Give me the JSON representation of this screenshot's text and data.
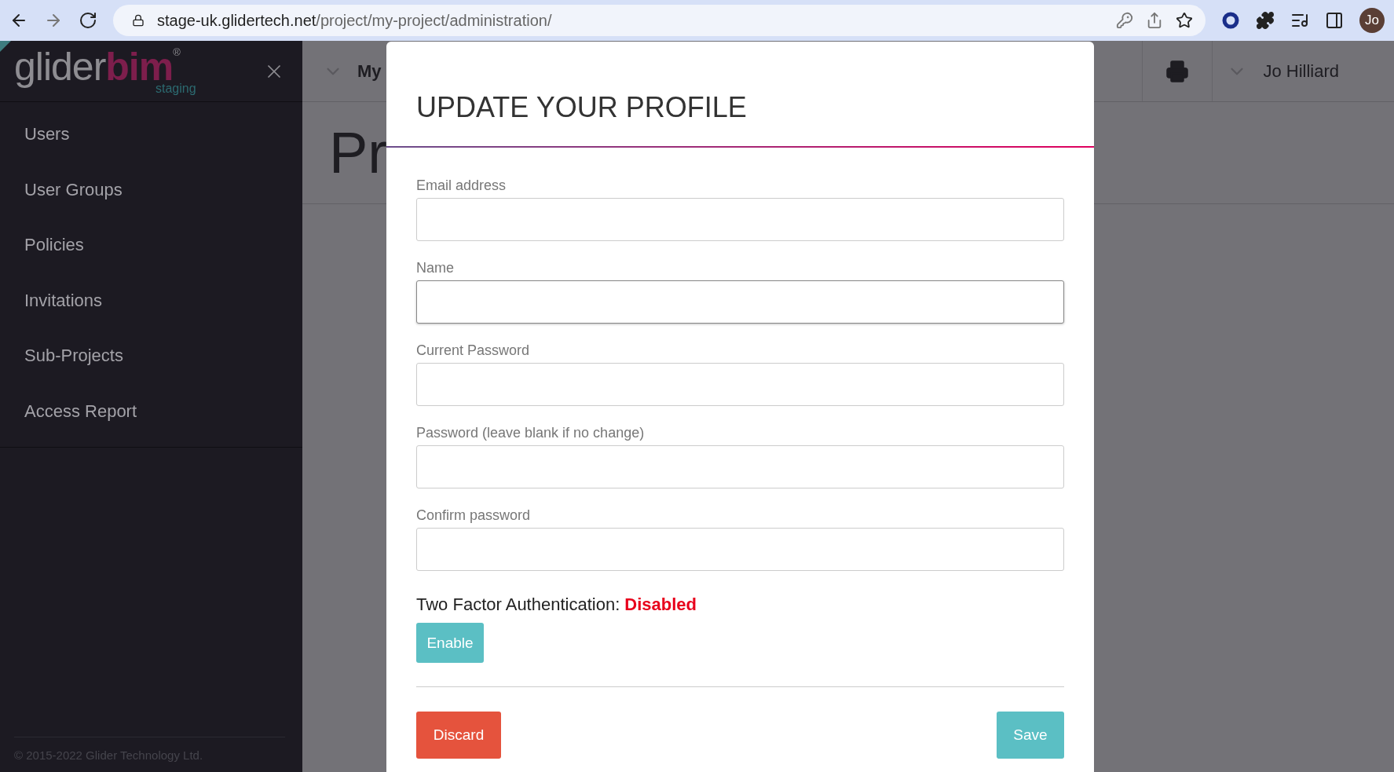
{
  "browser": {
    "url_host": "stage-uk.glidertech.net",
    "url_path": "/project/my-project/administration/",
    "avatar": "Jo"
  },
  "sidebar": {
    "logo": {
      "light": "glider",
      "bold": "bim",
      "mark": "®",
      "env": "staging"
    },
    "items": [
      {
        "label": "Users"
      },
      {
        "label": "User Groups"
      },
      {
        "label": "Policies"
      },
      {
        "label": "Invitations"
      },
      {
        "label": "Sub-Projects"
      },
      {
        "label": "Access Report"
      }
    ],
    "footer": "© 2015-2022 Glider Technology Ltd."
  },
  "header": {
    "project": "My",
    "user": "Jo Hilliard",
    "page_title": "Pr"
  },
  "modal": {
    "title": "UPDATE YOUR PROFILE",
    "fields": [
      {
        "label": "Email address",
        "focused": false
      },
      {
        "label": "Name",
        "focused": true
      },
      {
        "label": "Current Password",
        "focused": false
      },
      {
        "label": "Password (leave blank if no change)",
        "focused": false
      },
      {
        "label": "Confirm password",
        "focused": false
      }
    ],
    "two_factor": {
      "label": "Two Factor Authentication:",
      "status": "Disabled",
      "enabled": false
    },
    "enable_button": "Enable",
    "discard_button": "Discard",
    "save_button": "Save"
  }
}
